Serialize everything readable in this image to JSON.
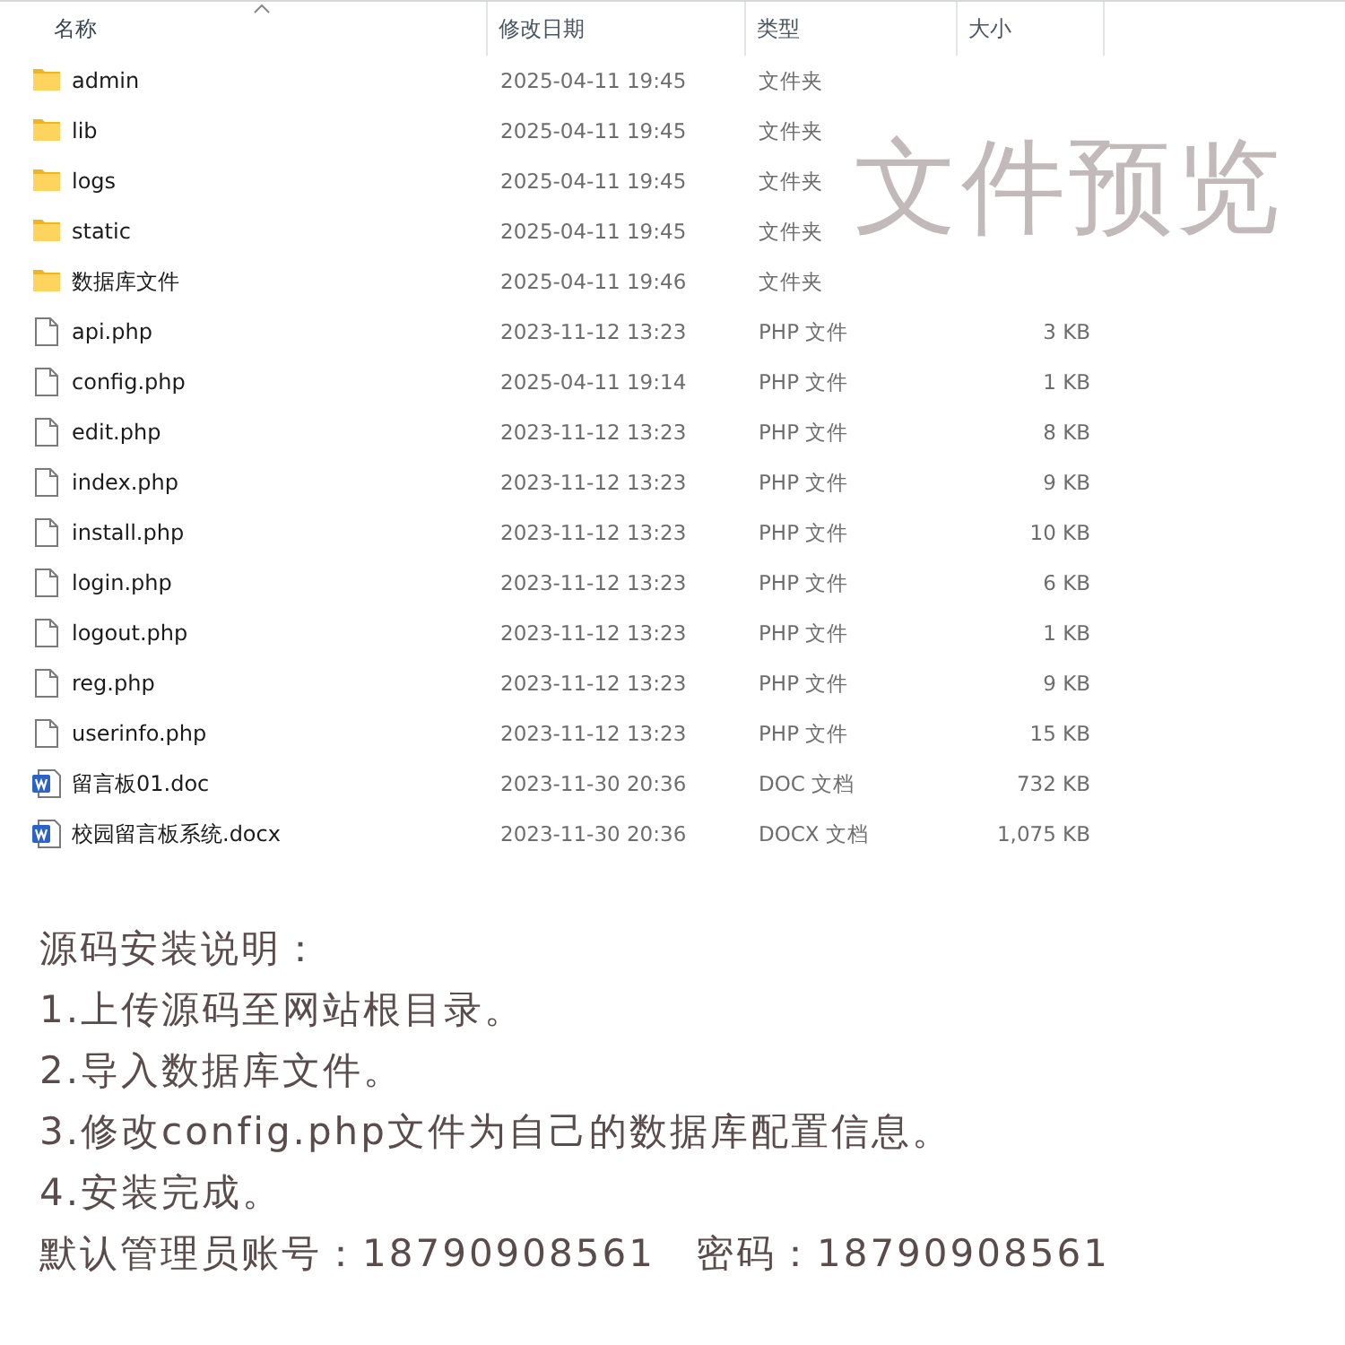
{
  "columns": [
    {
      "label": "名称",
      "sorted": true
    },
    {
      "label": "修改日期",
      "sorted": false
    },
    {
      "label": "类型",
      "sorted": false
    },
    {
      "label": "大小",
      "sorted": false
    }
  ],
  "files": [
    {
      "kind": "folder",
      "name": "admin",
      "modified": "2025-04-11 19:45",
      "type": "文件夹"
    },
    {
      "kind": "folder",
      "name": "lib",
      "modified": "2025-04-11 19:45",
      "type": "文件夹"
    },
    {
      "kind": "folder",
      "name": "logs",
      "modified": "2025-04-11 19:45",
      "type": "文件夹"
    },
    {
      "kind": "folder",
      "name": "static",
      "modified": "2025-04-11 19:45",
      "type": "文件夹"
    },
    {
      "kind": "folder",
      "name": "数据库文件",
      "modified": "2025-04-11 19:46",
      "type": "文件夹"
    },
    {
      "kind": "file",
      "name": "api.php",
      "modified": "2023-11-12 13:23",
      "type": "PHP 文件",
      "size": "3 KB"
    },
    {
      "kind": "file",
      "name": "config.php",
      "modified": "2025-04-11 19:14",
      "type": "PHP 文件",
      "size": "1 KB"
    },
    {
      "kind": "file",
      "name": "edit.php",
      "modified": "2023-11-12 13:23",
      "type": "PHP 文件",
      "size": "8 KB"
    },
    {
      "kind": "file",
      "name": "index.php",
      "modified": "2023-11-12 13:23",
      "type": "PHP 文件",
      "size": "9 KB"
    },
    {
      "kind": "file",
      "name": "install.php",
      "modified": "2023-11-12 13:23",
      "type": "PHP 文件",
      "size": "10 KB"
    },
    {
      "kind": "file",
      "name": "login.php",
      "modified": "2023-11-12 13:23",
      "type": "PHP 文件",
      "size": "6 KB"
    },
    {
      "kind": "file",
      "name": "logout.php",
      "modified": "2023-11-12 13:23",
      "type": "PHP 文件",
      "size": "1 KB"
    },
    {
      "kind": "file",
      "name": "reg.php",
      "modified": "2023-11-12 13:23",
      "type": "PHP 文件",
      "size": "9 KB"
    },
    {
      "kind": "file",
      "name": "userinfo.php",
      "modified": "2023-11-12 13:23",
      "type": "PHP 文件",
      "size": "15 KB"
    },
    {
      "kind": "document",
      "name": "留言板01.doc",
      "modified": "2023-11-30 20:36",
      "type": "DOC 文档",
      "size": "732 KB"
    },
    {
      "kind": "document",
      "name": "校园留言板系统.docx",
      "modified": "2023-11-30 20:36",
      "type": "DOCX 文档",
      "size": "1,075 KB"
    }
  ],
  "overlay_label": "文件预览",
  "instructions": [
    "源码安装说明：",
    "1.上传源码至网站根目录。",
    "2.导入数据库文件。",
    "3.修改config.php文件为自己的数据库配置信息。",
    "4.安装完成。",
    "默认管理员账号：18790908561　密码：18790908561"
  ]
}
